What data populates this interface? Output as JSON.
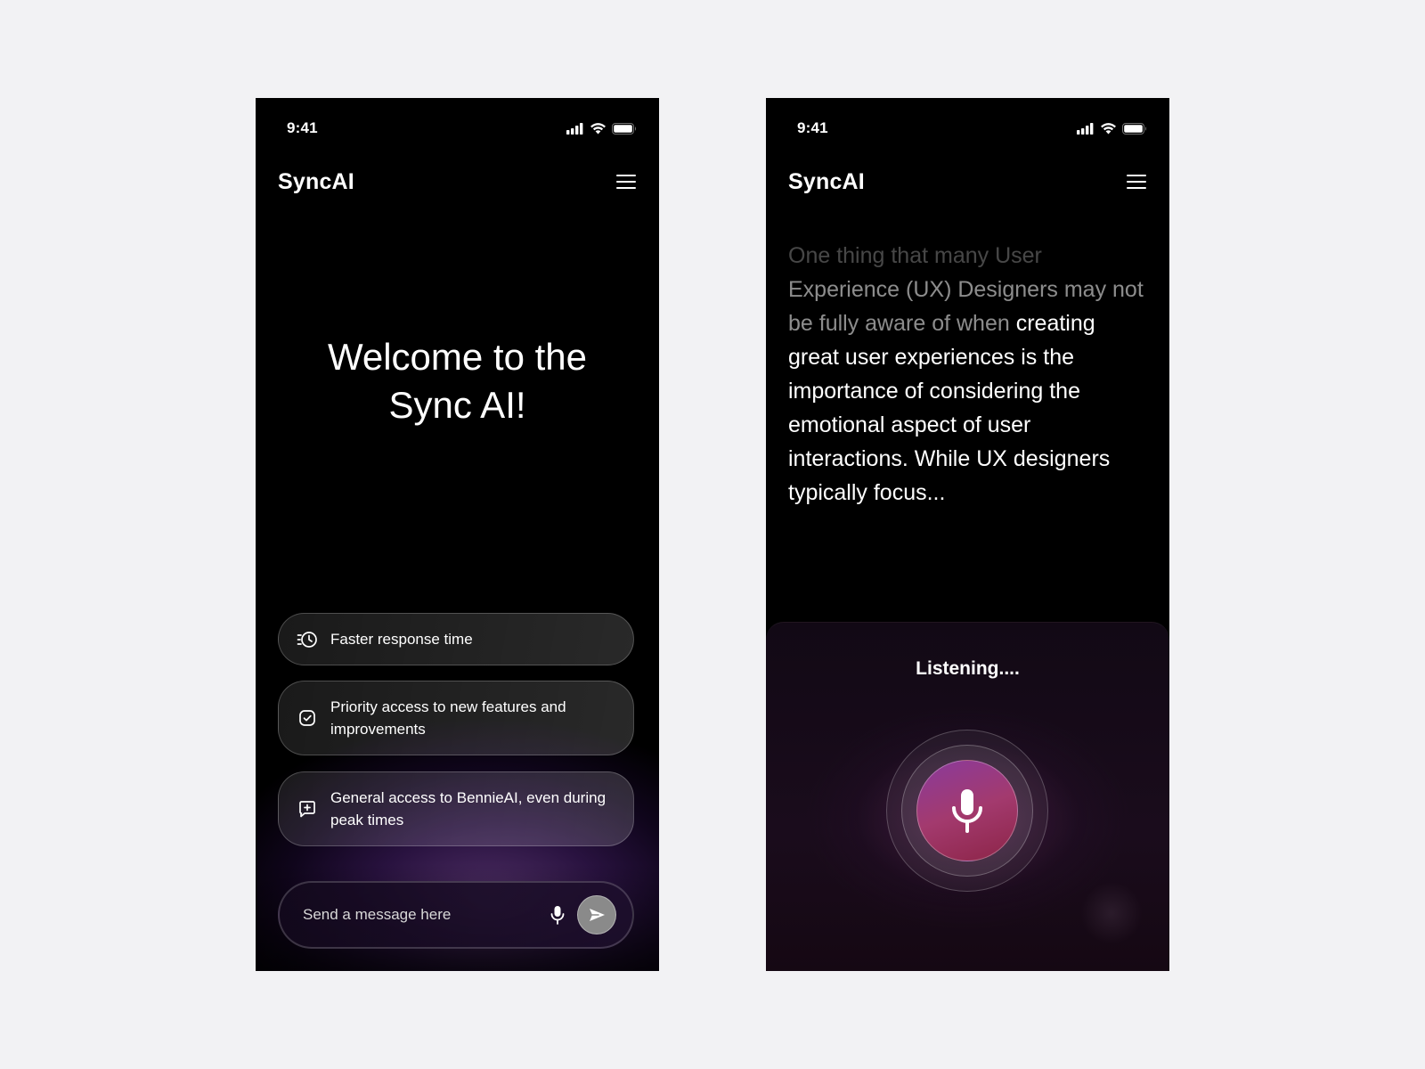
{
  "screens": {
    "home": {
      "status": {
        "time": "9:41"
      },
      "header": {
        "title": "SyncAI"
      },
      "welcome": {
        "line1": "Welcome to the",
        "line2": "Sync AI!"
      },
      "features": [
        {
          "icon": "history-clock-icon",
          "text": "Faster response time"
        },
        {
          "icon": "check-square-icon",
          "text": "Priority access to new features and improvements"
        },
        {
          "icon": "message-plus-icon",
          "text": "General access to BennieAI, even during peak times"
        }
      ],
      "composer": {
        "placeholder": "Send a message here",
        "mic_icon": "mic-icon",
        "send_icon": "send-icon"
      }
    },
    "voice": {
      "status": {
        "time": "9:41"
      },
      "header": {
        "title": "SyncAI"
      },
      "transcript": {
        "faint": "One thing that many User",
        "mid": "Experience (UX) Designers may not be fully aware of when",
        "full": "creating great user experiences is the importance of considering the emotional aspect of user interactions. While UX designers typically focus..."
      },
      "listening_label": "Listening....",
      "mic_icon": "mic-icon"
    }
  },
  "colors": {
    "page_background": "#f2f2f4",
    "screen_background": "#000000",
    "glow_purple": "#5a2890",
    "mic_gradient_start": "#8a3a9c",
    "mic_gradient_end": "#8c2447",
    "send_button": "#8a8a8a"
  }
}
